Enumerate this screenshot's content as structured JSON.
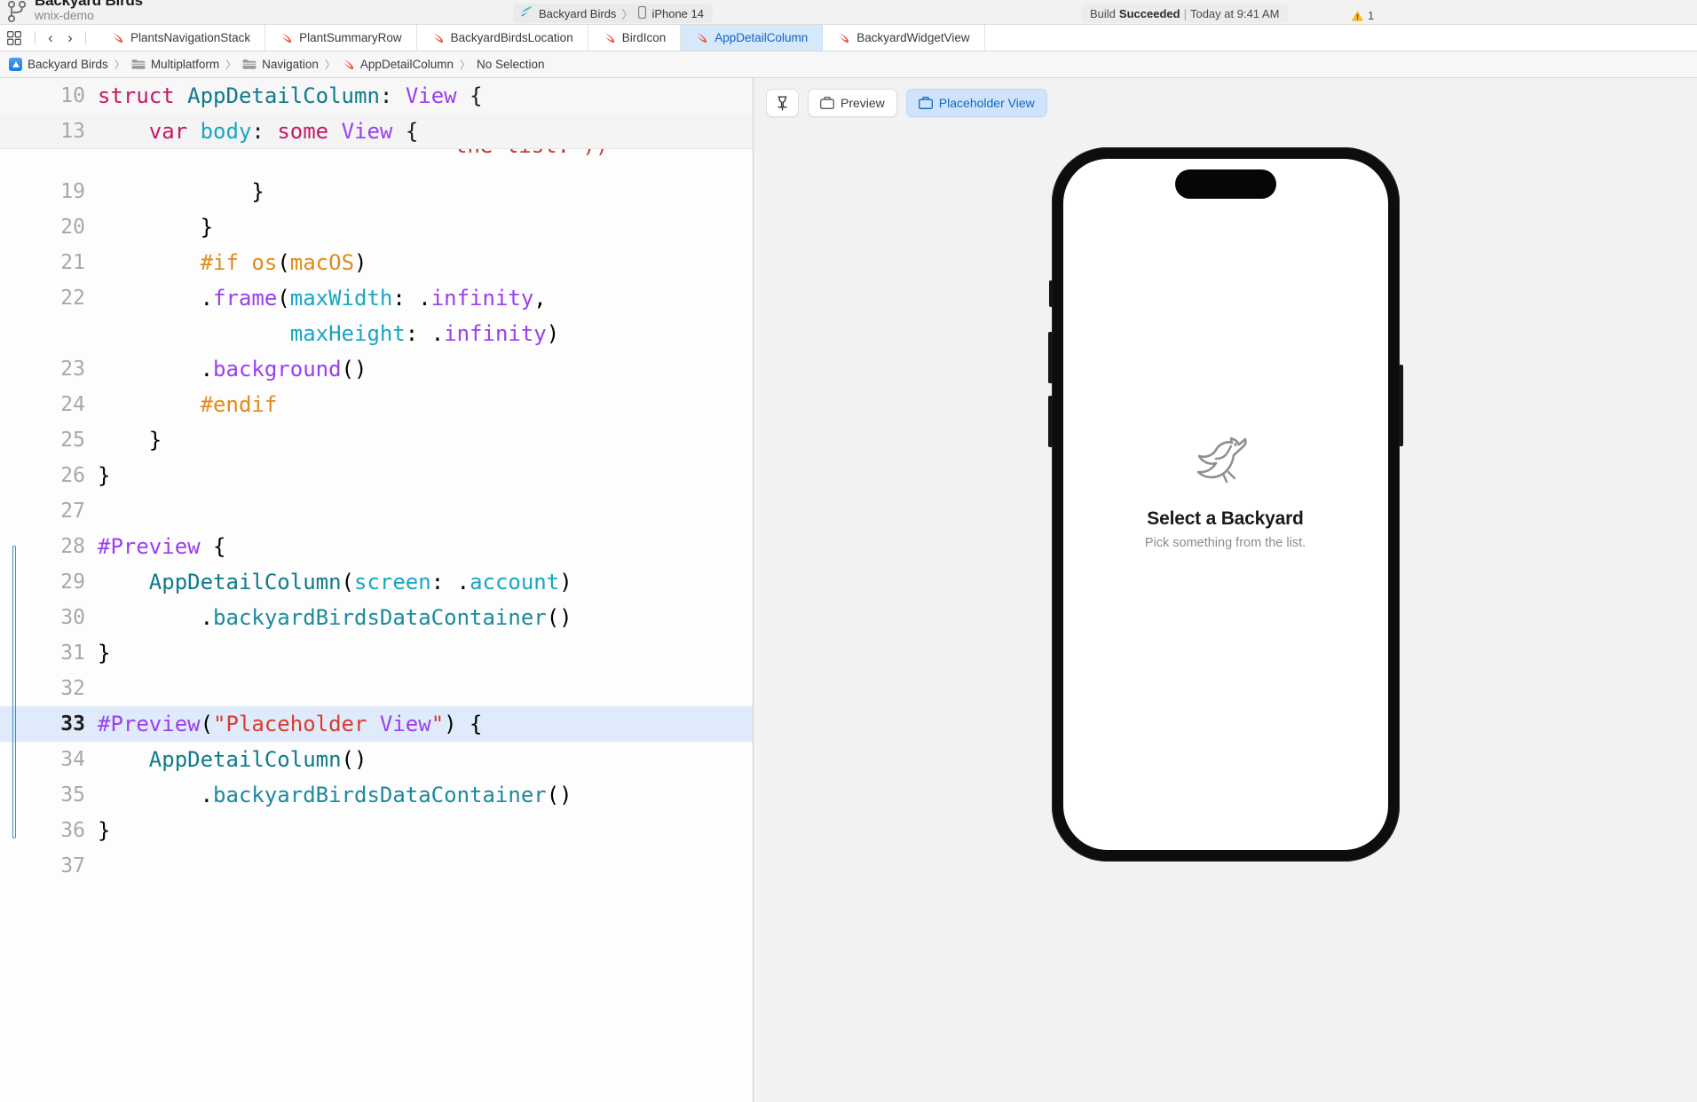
{
  "toolbar": {
    "project_name": "Backyard Birds",
    "project_branch": "wnix-demo",
    "scheme": "Backyard Birds",
    "scheme_separator": "〉",
    "destination": "iPhone 14",
    "status_prefix": "Build",
    "status_result": "Succeeded",
    "status_divider": "|",
    "status_time": "Today at 9:41 AM",
    "warning_count": "1"
  },
  "tabbar": {
    "back_glyph": "‹",
    "forward_glyph": "›",
    "tabs": [
      {
        "label": "PlantsNavigationStack",
        "active": false
      },
      {
        "label": "PlantSummaryRow",
        "active": false
      },
      {
        "label": "BackyardBirdsLocation",
        "active": false
      },
      {
        "label": "BirdIcon",
        "active": false
      },
      {
        "label": "AppDetailColumn",
        "active": true
      },
      {
        "label": "BackyardWidgetView",
        "active": false
      }
    ]
  },
  "breadcrumb": {
    "separator": "〉",
    "items": [
      {
        "label": "Backyard Birds",
        "icon": "app-icon"
      },
      {
        "label": "Multiplatform",
        "icon": "folder-icon"
      },
      {
        "label": "Navigation",
        "icon": "folder-icon"
      },
      {
        "label": "AppDetailColumn",
        "icon": "swift-icon"
      },
      {
        "label": "No Selection",
        "icon": "none"
      }
    ]
  },
  "editor": {
    "sticky_lines": [
      {
        "number": "10",
        "text": "struct AppDetailColumn: View {"
      },
      {
        "number": "13",
        "text": "    var body: some View {"
      }
    ],
    "scrolled_fragment": "the list.\"))",
    "lines": [
      {
        "number": "19",
        "text": "            }"
      },
      {
        "number": "20",
        "text": "        }"
      },
      {
        "number": "21",
        "text": "        #if os(macOS)"
      },
      {
        "number": "22",
        "text": "        .frame(maxWidth: .infinity,"
      },
      {
        "number": "",
        "text": "               maxHeight: .infinity)"
      },
      {
        "number": "23",
        "text": "        .background()"
      },
      {
        "number": "24",
        "text": "        #endif"
      },
      {
        "number": "25",
        "text": "    }"
      },
      {
        "number": "26",
        "text": "}"
      },
      {
        "number": "27",
        "text": ""
      },
      {
        "number": "28",
        "text": "#Preview {"
      },
      {
        "number": "29",
        "text": "    AppDetailColumn(screen: .account)"
      },
      {
        "number": "30",
        "text": "        .backyardBirdsDataContainer()"
      },
      {
        "number": "31",
        "text": "}"
      },
      {
        "number": "32",
        "text": ""
      },
      {
        "number": "33",
        "text": "#Preview(\"Placeholder View\") {"
      },
      {
        "number": "34",
        "text": "    AppDetailColumn()"
      },
      {
        "number": "35",
        "text": "        .backyardBirdsDataContainer()"
      },
      {
        "number": "36",
        "text": "}"
      },
      {
        "number": "37",
        "text": ""
      }
    ],
    "highlighted_line": "33",
    "cursor_after": "Placeholder View"
  },
  "preview": {
    "pin_label": "pin-icon",
    "buttons": [
      {
        "label": "Preview",
        "selected": false
      },
      {
        "label": "Placeholder View",
        "selected": true
      }
    ],
    "device": {
      "title": "Select a Backyard",
      "subtitle": "Pick something from the list."
    }
  },
  "colors": {
    "accent_blue": "#1165c4",
    "tab_active_bg": "#d6e8fb",
    "line_highlight": "#dfebfa",
    "keyword_pink": "#c41a66",
    "type_teal": "#0f7b8a",
    "macro_purple": "#9a3ff0",
    "preproc_orange": "#e08c1a",
    "string_red": "#d93b30",
    "property_cyan": "#19a6c4",
    "warning_yellow": "#f0b429"
  }
}
